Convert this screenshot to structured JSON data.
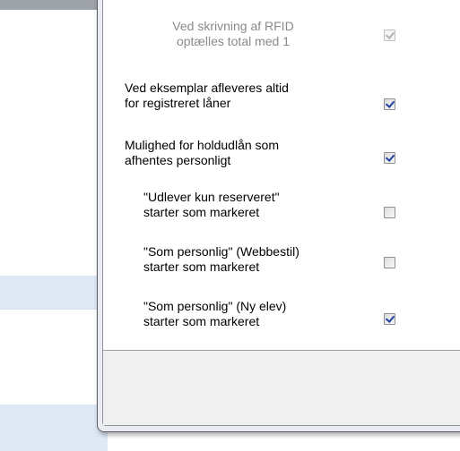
{
  "options": [
    {
      "label_line1": "Ved skrivning af RFID",
      "label_line2": "optælles total med 1",
      "checked": true,
      "enabled": false
    },
    {
      "label_line1": "Ved eksemplar afleveres altid",
      "label_line2": "for registreret låner",
      "checked": true,
      "enabled": true
    },
    {
      "label_line1": "Mulighed for holdudlån som",
      "label_line2": "afhentes personligt",
      "checked": true,
      "enabled": true
    },
    {
      "label_line1": "\"Udlever kun reserveret\"",
      "label_line2": "starter som markeret",
      "checked": false,
      "enabled": true
    },
    {
      "label_line1": "\"Som personlig\" (Webbestil)",
      "label_line2": "starter som markeret",
      "checked": false,
      "enabled": true
    },
    {
      "label_line1": "\"Som personlig\" (Ny elev)",
      "label_line2": "starter som markeret",
      "checked": true,
      "enabled": true
    }
  ]
}
